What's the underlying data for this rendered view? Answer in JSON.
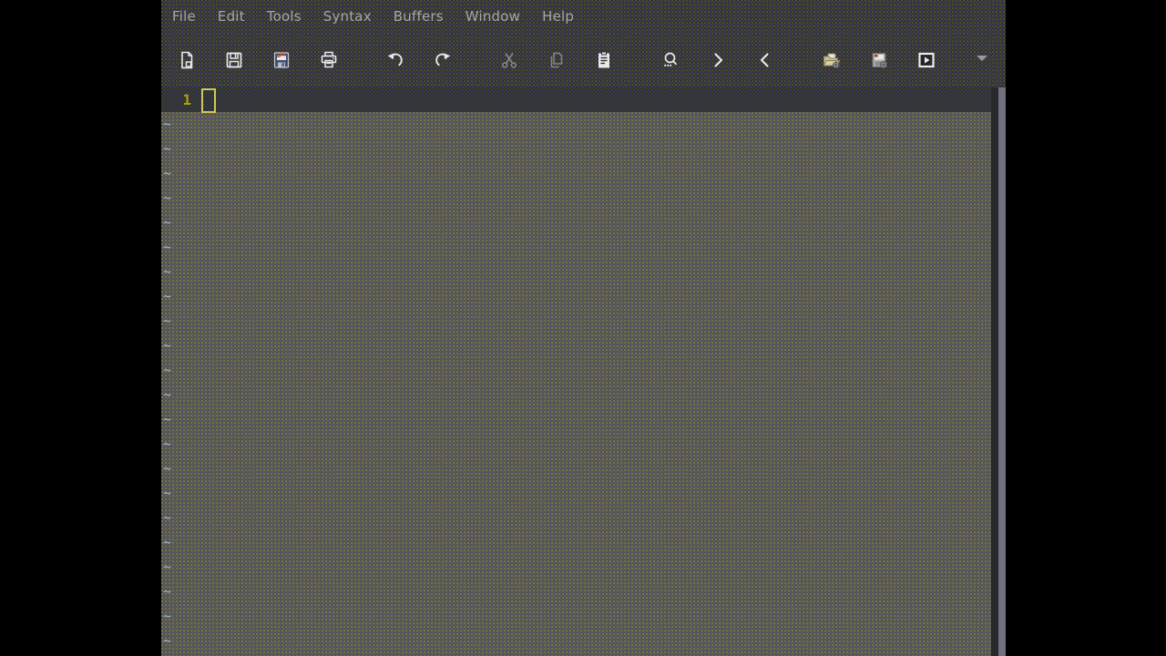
{
  "window": {
    "app": "gvim-text-editor",
    "state": "empty-unnamed-buffer"
  },
  "palette": {
    "desktop_bg": "#000000",
    "chrome_bg": "#2e2e31",
    "menu_text": "#a6a6a6",
    "buffer_line_bg": "#2c2e32",
    "nontext_bg": "#4c4d4f",
    "tilde_color": "#9fb9cf",
    "line_number_color": "#ab9f10",
    "cursor_outline": "#d3c756",
    "icon_enabled": "#e9e9e9",
    "icon_disabled": "#85858a",
    "scrollbar_trough": "#28282c",
    "scrollbar_thumb": "#6f727e"
  },
  "menubar": {
    "items": [
      {
        "label": "File"
      },
      {
        "label": "Edit"
      },
      {
        "label": "Tools"
      },
      {
        "label": "Syntax"
      },
      {
        "label": "Buffers"
      },
      {
        "label": "Window"
      },
      {
        "label": "Help"
      }
    ]
  },
  "toolbar": {
    "buttons": [
      {
        "icon": "new-file-icon",
        "enabled": true
      },
      {
        "icon": "save-floppy-icon",
        "enabled": true
      },
      {
        "icon": "save-all-color-floppy-icon",
        "enabled": true
      },
      {
        "icon": "print-icon",
        "enabled": true
      },
      {
        "icon": "undo-arrow-icon",
        "enabled": true
      },
      {
        "icon": "redo-arrow-icon",
        "enabled": true
      },
      {
        "icon": "cut-scissors-icon",
        "enabled": false
      },
      {
        "icon": "copy-pages-icon",
        "enabled": false
      },
      {
        "icon": "paste-clipboard-icon",
        "enabled": true
      },
      {
        "icon": "find-magnifier-icon",
        "enabled": true
      },
      {
        "icon": "find-next-chevron-right-icon",
        "enabled": true
      },
      {
        "icon": "find-prev-chevron-left-icon",
        "enabled": true
      },
      {
        "icon": "load-session-folder-icon",
        "enabled": true
      },
      {
        "icon": "save-session-disk-icon",
        "enabled": true
      },
      {
        "icon": "run-script-window-play-icon",
        "enabled": true
      },
      {
        "icon": "toolbar-overflow-arrow-icon",
        "enabled": true
      }
    ]
  },
  "editor": {
    "line_numbers": [
      "1"
    ],
    "buffer_lines": [
      ""
    ],
    "empty_line_marker": "~",
    "empty_line_rows": 22,
    "cursor": {
      "line": 1,
      "col": 1,
      "shape": "hollow-block"
    }
  },
  "scrollbar": {
    "thumb_extent": "full-height"
  }
}
